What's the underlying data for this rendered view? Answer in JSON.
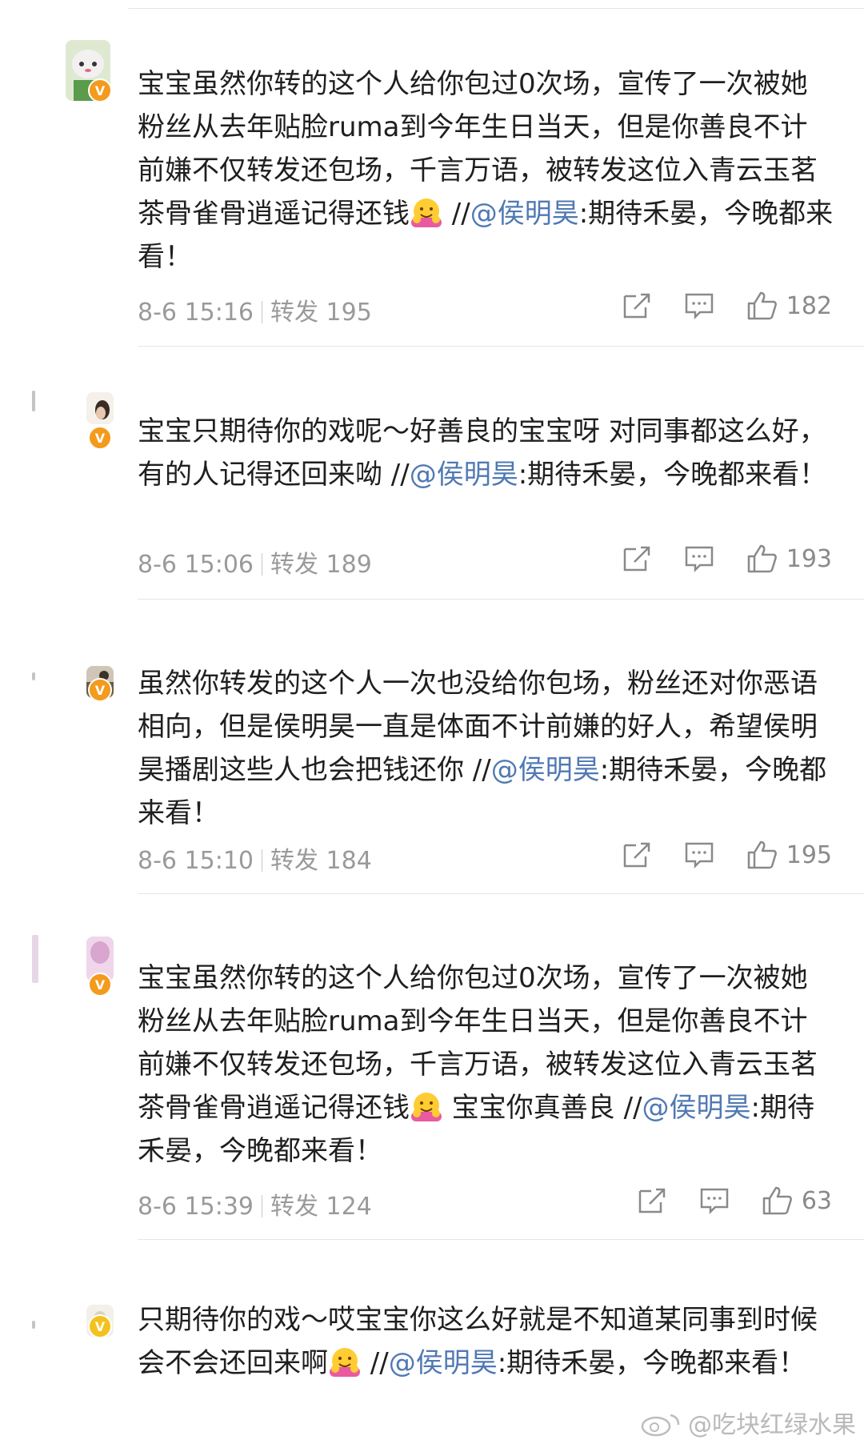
{
  "comments": [
    {
      "text_before_emoji": "宝宝虽然你转的这个人给你包过0次场，宣传了一次被她粉丝从去年贴脸ruma到今年生日当天，但是你善良不计前嫌不仅转发还包场，千言万语，被转发这位入青云玉茗茶骨雀骨逍遥记得还钱",
      "text_after_emoji": " //",
      "mention": "@侯明昊",
      "text_tail": ":期待禾晏，今晚都来看！",
      "time": "8-6 15:16",
      "repost_label": "转发 195",
      "likes": "182",
      "avatar_icon": "cartoon-avatar-icon"
    },
    {
      "text_before_emoji": "宝宝只期待你的戏呢～好善良的宝宝呀 对同事都这么好，有的人记得还回来呦 //",
      "mention": "@侯明昊",
      "text_tail": ":期待禾晏，今晚都来看！",
      "time": "8-6 15:06",
      "repost_label": "转发 189",
      "likes": "193",
      "avatar_icon": "person-avatar-icon"
    },
    {
      "text_before_emoji": "虽然你转发的这个人一次也没给你包场，粉丝还对你恶语相向，但是侯明昊一直是体面不计前嫌的好人，希望侯明昊播剧这些人也会把钱还你 //",
      "mention": "@侯明昊",
      "text_tail": ":期待禾晏，今晚都来看！",
      "time": "8-6 15:10",
      "repost_label": "转发 184",
      "likes": "195",
      "avatar_icon": "scene-avatar-icon"
    },
    {
      "text_before_emoji": "宝宝虽然你转的这个人给你包过0次场，宣传了一次被她粉丝从去年贴脸ruma到今年生日当天，但是你善良不计前嫌不仅转发还包场，千言万语，被转发这位入青云玉茗茶骨雀骨逍遥记得还钱",
      "text_after_emoji": " 宝宝你真善良 //",
      "mention": "@侯明昊",
      "text_tail": ":期待禾晏，今晚都来看！",
      "time": "8-6 15:39",
      "repost_label": "转发 124",
      "likes": "63",
      "avatar_icon": "pink-avatar-icon"
    },
    {
      "text_before_emoji": "只期待你的戏～哎宝宝你这么好就是不知道某同事到时候会不会还回来啊",
      "text_after_emoji": " //",
      "mention": "@侯明昊",
      "text_tail": ":期待禾晏，今晚都来看！",
      "avatar_icon": "figure-avatar-icon"
    }
  ],
  "icons": {
    "share": "share-icon",
    "comment": "comment-icon",
    "like": "thumbs-up-icon",
    "emoji": "hugging-face-emoji-icon",
    "verified": "verified-v-badge-icon"
  },
  "watermark": "@吃块红绿水果",
  "colors": {
    "mention": "#5079b4",
    "badge": "#f49a1c",
    "meta": "#9a9a9a"
  }
}
